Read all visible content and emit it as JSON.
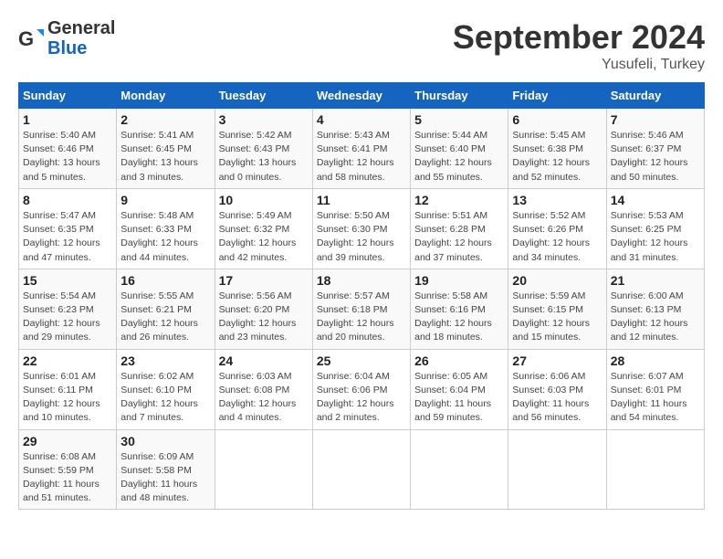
{
  "header": {
    "logo_line1": "General",
    "logo_line2": "Blue",
    "month_title": "September 2024",
    "location": "Yusufeli, Turkey"
  },
  "days_of_week": [
    "Sunday",
    "Monday",
    "Tuesday",
    "Wednesday",
    "Thursday",
    "Friday",
    "Saturday"
  ],
  "weeks": [
    [
      {
        "day": 1,
        "info": "Sunrise: 5:40 AM\nSunset: 6:46 PM\nDaylight: 13 hours\nand 5 minutes."
      },
      {
        "day": 2,
        "info": "Sunrise: 5:41 AM\nSunset: 6:45 PM\nDaylight: 13 hours\nand 3 minutes."
      },
      {
        "day": 3,
        "info": "Sunrise: 5:42 AM\nSunset: 6:43 PM\nDaylight: 13 hours\nand 0 minutes."
      },
      {
        "day": 4,
        "info": "Sunrise: 5:43 AM\nSunset: 6:41 PM\nDaylight: 12 hours\nand 58 minutes."
      },
      {
        "day": 5,
        "info": "Sunrise: 5:44 AM\nSunset: 6:40 PM\nDaylight: 12 hours\nand 55 minutes."
      },
      {
        "day": 6,
        "info": "Sunrise: 5:45 AM\nSunset: 6:38 PM\nDaylight: 12 hours\nand 52 minutes."
      },
      {
        "day": 7,
        "info": "Sunrise: 5:46 AM\nSunset: 6:37 PM\nDaylight: 12 hours\nand 50 minutes."
      }
    ],
    [
      {
        "day": 8,
        "info": "Sunrise: 5:47 AM\nSunset: 6:35 PM\nDaylight: 12 hours\nand 47 minutes."
      },
      {
        "day": 9,
        "info": "Sunrise: 5:48 AM\nSunset: 6:33 PM\nDaylight: 12 hours\nand 44 minutes."
      },
      {
        "day": 10,
        "info": "Sunrise: 5:49 AM\nSunset: 6:32 PM\nDaylight: 12 hours\nand 42 minutes."
      },
      {
        "day": 11,
        "info": "Sunrise: 5:50 AM\nSunset: 6:30 PM\nDaylight: 12 hours\nand 39 minutes."
      },
      {
        "day": 12,
        "info": "Sunrise: 5:51 AM\nSunset: 6:28 PM\nDaylight: 12 hours\nand 37 minutes."
      },
      {
        "day": 13,
        "info": "Sunrise: 5:52 AM\nSunset: 6:26 PM\nDaylight: 12 hours\nand 34 minutes."
      },
      {
        "day": 14,
        "info": "Sunrise: 5:53 AM\nSunset: 6:25 PM\nDaylight: 12 hours\nand 31 minutes."
      }
    ],
    [
      {
        "day": 15,
        "info": "Sunrise: 5:54 AM\nSunset: 6:23 PM\nDaylight: 12 hours\nand 29 minutes."
      },
      {
        "day": 16,
        "info": "Sunrise: 5:55 AM\nSunset: 6:21 PM\nDaylight: 12 hours\nand 26 minutes."
      },
      {
        "day": 17,
        "info": "Sunrise: 5:56 AM\nSunset: 6:20 PM\nDaylight: 12 hours\nand 23 minutes."
      },
      {
        "day": 18,
        "info": "Sunrise: 5:57 AM\nSunset: 6:18 PM\nDaylight: 12 hours\nand 20 minutes."
      },
      {
        "day": 19,
        "info": "Sunrise: 5:58 AM\nSunset: 6:16 PM\nDaylight: 12 hours\nand 18 minutes."
      },
      {
        "day": 20,
        "info": "Sunrise: 5:59 AM\nSunset: 6:15 PM\nDaylight: 12 hours\nand 15 minutes."
      },
      {
        "day": 21,
        "info": "Sunrise: 6:00 AM\nSunset: 6:13 PM\nDaylight: 12 hours\nand 12 minutes."
      }
    ],
    [
      {
        "day": 22,
        "info": "Sunrise: 6:01 AM\nSunset: 6:11 PM\nDaylight: 12 hours\nand 10 minutes."
      },
      {
        "day": 23,
        "info": "Sunrise: 6:02 AM\nSunset: 6:10 PM\nDaylight: 12 hours\nand 7 minutes."
      },
      {
        "day": 24,
        "info": "Sunrise: 6:03 AM\nSunset: 6:08 PM\nDaylight: 12 hours\nand 4 minutes."
      },
      {
        "day": 25,
        "info": "Sunrise: 6:04 AM\nSunset: 6:06 PM\nDaylight: 12 hours\nand 2 minutes."
      },
      {
        "day": 26,
        "info": "Sunrise: 6:05 AM\nSunset: 6:04 PM\nDaylight: 11 hours\nand 59 minutes."
      },
      {
        "day": 27,
        "info": "Sunrise: 6:06 AM\nSunset: 6:03 PM\nDaylight: 11 hours\nand 56 minutes."
      },
      {
        "day": 28,
        "info": "Sunrise: 6:07 AM\nSunset: 6:01 PM\nDaylight: 11 hours\nand 54 minutes."
      }
    ],
    [
      {
        "day": 29,
        "info": "Sunrise: 6:08 AM\nSunset: 5:59 PM\nDaylight: 11 hours\nand 51 minutes."
      },
      {
        "day": 30,
        "info": "Sunrise: 6:09 AM\nSunset: 5:58 PM\nDaylight: 11 hours\nand 48 minutes."
      },
      null,
      null,
      null,
      null,
      null
    ]
  ]
}
